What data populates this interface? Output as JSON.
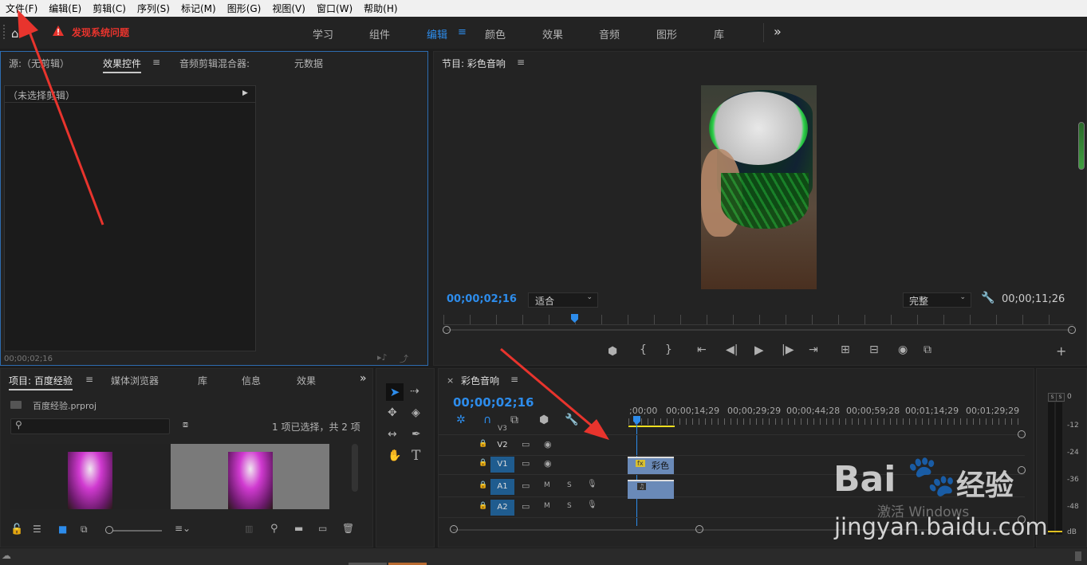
{
  "menu": [
    "文件(F)",
    "编辑(E)",
    "剪辑(C)",
    "序列(S)",
    "标记(M)",
    "图形(G)",
    "视图(V)",
    "窗口(W)",
    "帮助(H)"
  ],
  "alert": {
    "text": "发现系统问题"
  },
  "workspaces": {
    "items": [
      "学习",
      "组件",
      "编辑",
      "颜色",
      "效果",
      "音频",
      "图形",
      "库"
    ],
    "active": "编辑"
  },
  "source_panel": {
    "tabs": [
      "源:（无剪辑）",
      "效果控件",
      "音频剪辑混合器:",
      "元数据"
    ],
    "active_tab": "效果控件",
    "no_clip": "（未选择剪辑）",
    "timecode": "00;00;02;16"
  },
  "program": {
    "title": "节目: 彩色音响",
    "current_tc": "00;00;02;16",
    "fit": "适合",
    "quality": "完整",
    "duration": "00;00;11;26"
  },
  "project": {
    "tabs": [
      "项目: 百度经验",
      "媒体浏览器",
      "库",
      "信息",
      "效果"
    ],
    "file": "百度经验.prproj",
    "selection": "1 项已选择，共 2 项",
    "search_placeholder": ""
  },
  "timeline": {
    "title": "彩色音响",
    "timecode": "00;00;02;16",
    "ruler": [
      ";00;00",
      "00;00;14;29",
      "00;00;29;29",
      "00;00;44;28",
      "00;00;59;28",
      "00;01;14;29",
      "00;01;29;29"
    ],
    "tracks": [
      {
        "name": "V3",
        "type": "video"
      },
      {
        "name": "V2",
        "type": "video"
      },
      {
        "name": "V1",
        "type": "video"
      },
      {
        "name": "A1",
        "type": "audio"
      },
      {
        "name": "A2",
        "type": "audio"
      }
    ],
    "clip_label": "彩色",
    "mute": "M",
    "solo": "S"
  },
  "meter": {
    "scale": [
      "0",
      "-12",
      "-24",
      "-36",
      "-48",
      "dB"
    ],
    "top": [
      "S",
      "S"
    ]
  },
  "watermark": {
    "brand": "Bai",
    "brand2": "经验",
    "url": "jingyan.baidu.com",
    "activate": "激活 Windows"
  },
  "colors": {
    "accent": "#2d8ceb",
    "panel": "#232323",
    "bg": "#1d1d1d",
    "clip_video": "#6a8ab8",
    "track_active": "#1f5c8f",
    "alert": "#e8342d"
  }
}
